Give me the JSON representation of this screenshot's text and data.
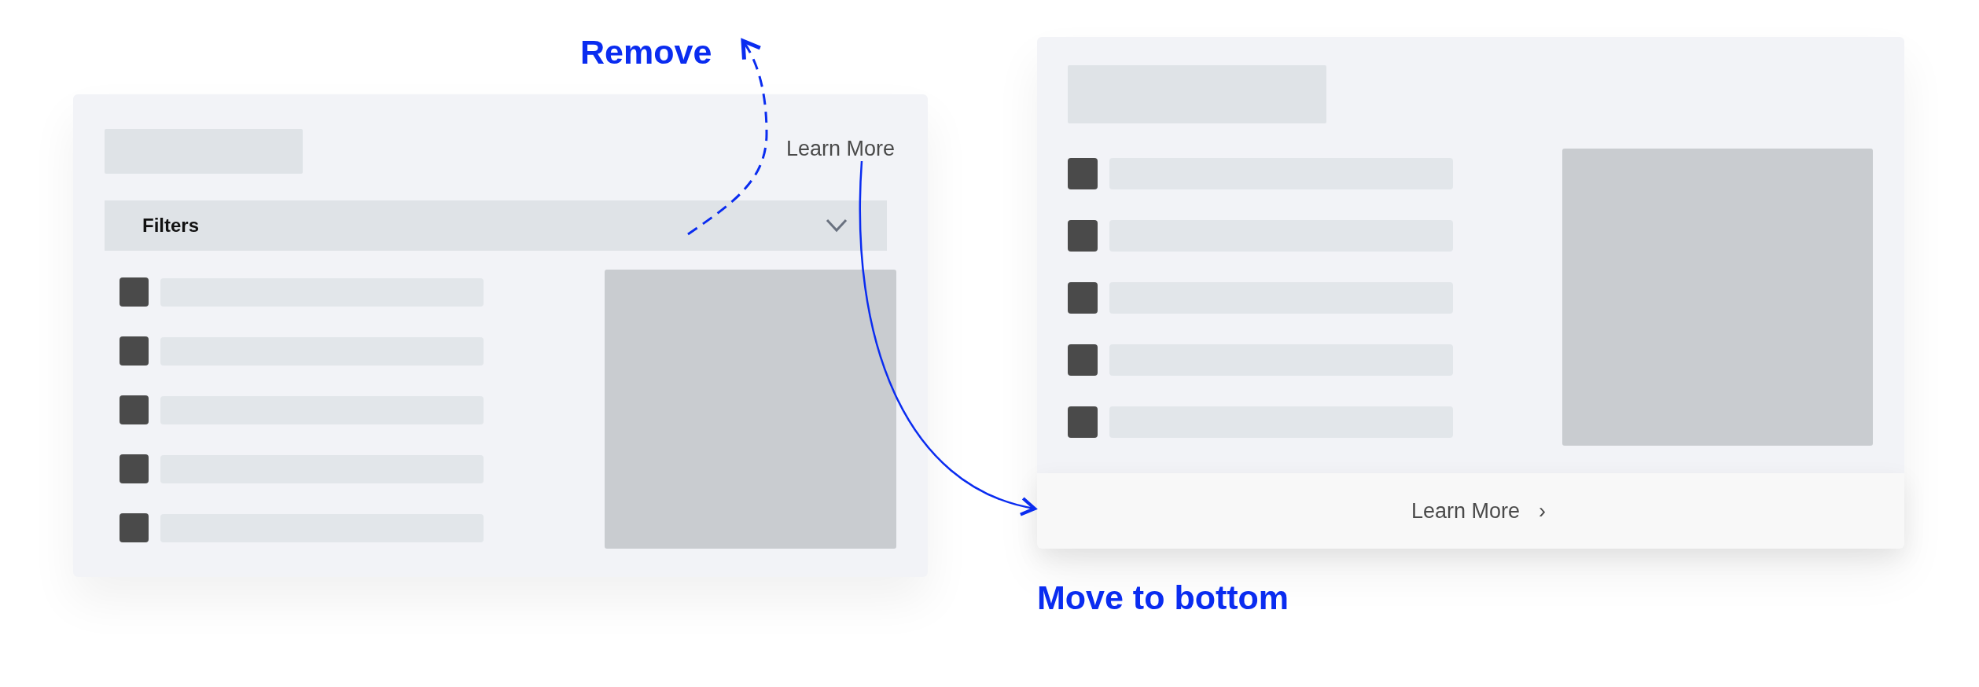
{
  "annotations": [
    {
      "kind": "remove",
      "label": "Remove"
    },
    {
      "kind": "move",
      "label": "Move to bottom"
    }
  ],
  "before": {
    "link": "Learn More",
    "filter_bar": {
      "label": "Filters",
      "expanded": false
    },
    "rows": [
      {
        "kind": "checkbox-row",
        "checked": true
      },
      {
        "kind": "checkbox-row",
        "checked": true
      },
      {
        "kind": "checkbox-row",
        "checked": true
      },
      {
        "kind": "checkbox-row",
        "checked": true
      },
      {
        "kind": "checkbox-row",
        "checked": true
      }
    ]
  },
  "after": {
    "rows": [
      {
        "kind": "checkbox-row",
        "checked": true
      },
      {
        "kind": "checkbox-row",
        "checked": true
      },
      {
        "kind": "checkbox-row",
        "checked": true
      },
      {
        "kind": "checkbox-row",
        "checked": true
      },
      {
        "kind": "checkbox-row",
        "checked": true
      }
    ],
    "footer": {
      "label": "Learn More",
      "icon": "›"
    }
  }
}
